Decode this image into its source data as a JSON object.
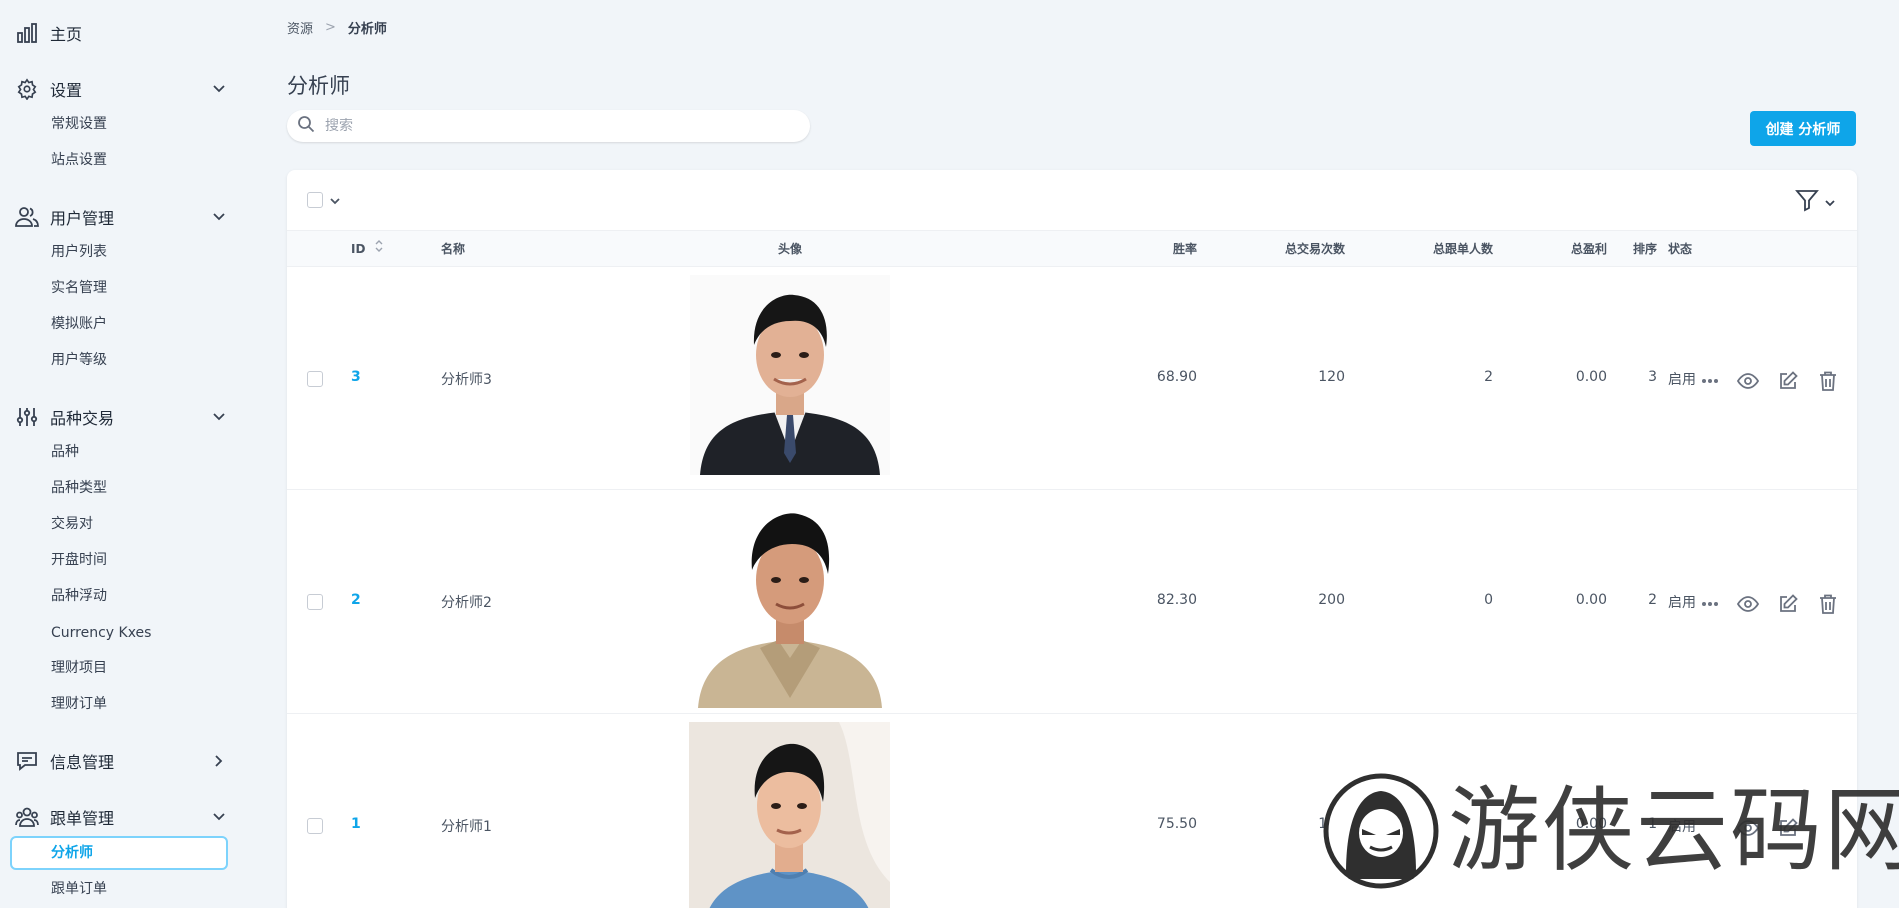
{
  "sidebar": {
    "home": "主页",
    "settings": {
      "label": "设置",
      "items": [
        "常规设置",
        "站点设置"
      ]
    },
    "users": {
      "label": "用户管理",
      "items": [
        "用户列表",
        "实名管理",
        "模拟账户",
        "用户等级"
      ]
    },
    "trading": {
      "label": "品种交易",
      "items": [
        "品种",
        "品种类型",
        "交易对",
        "开盘时间",
        "品种浮动",
        "Currency Kxes",
        "理财项目",
        "理财订单"
      ]
    },
    "messages": {
      "label": "信息管理"
    },
    "follow": {
      "label": "跟单管理",
      "items": [
        "分析师",
        "跟单订单"
      ]
    }
  },
  "breadcrumb": {
    "root": "资源",
    "current": "分析师"
  },
  "page": {
    "title": "分析师",
    "search_placeholder": "搜索",
    "create_button": "创建 分析师"
  },
  "table": {
    "headers": {
      "id": "ID",
      "name": "名称",
      "avatar": "头像",
      "win_rate": "胜率",
      "trades": "总交易次数",
      "followers": "总跟单人数",
      "profit": "总盈利",
      "sort": "排序",
      "status": "状态"
    },
    "rows": [
      {
        "id": "3",
        "name": "分析师3",
        "win_rate": "68.90",
        "trades": "120",
        "followers": "2",
        "profit": "0.00",
        "sort": "3",
        "status": "启用"
      },
      {
        "id": "2",
        "name": "分析师2",
        "win_rate": "82.30",
        "trades": "200",
        "followers": "0",
        "profit": "0.00",
        "sort": "2",
        "status": "启用"
      },
      {
        "id": "1",
        "name": "分析师1",
        "win_rate": "75.50",
        "trades": "150",
        "followers": "",
        "profit": "0.00",
        "sort": "1",
        "status": "启用"
      }
    ]
  },
  "watermark": "游侠云码网",
  "colors": {
    "accent": "#0ea5e9",
    "background": "#f1f5f9"
  }
}
